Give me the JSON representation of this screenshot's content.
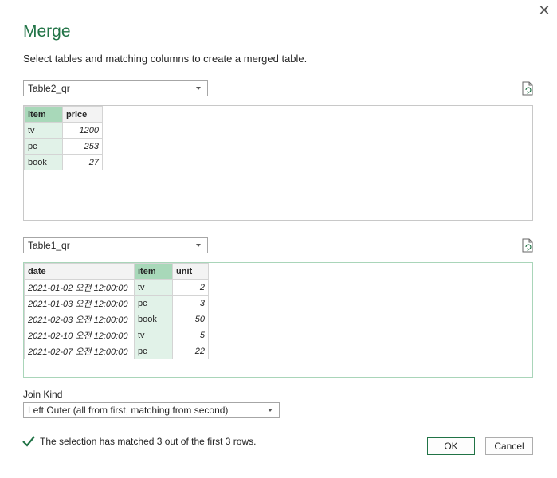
{
  "dialog": {
    "title": "Merge",
    "subtitle": "Select tables and matching columns to create a merged table."
  },
  "top_table": {
    "selected": "Table2_qr",
    "columns": [
      "item",
      "price"
    ],
    "rows": [
      [
        "tv",
        "1200"
      ],
      [
        "pc",
        "253"
      ],
      [
        "book",
        "27"
      ]
    ]
  },
  "bottom_table": {
    "selected": "Table1_qr",
    "columns": [
      "date",
      "item",
      "unit"
    ],
    "rows": [
      [
        "2021-01-02 오전 12:00:00",
        "tv",
        "2"
      ],
      [
        "2021-01-03 오전 12:00:00",
        "pc",
        "3"
      ],
      [
        "2021-02-03 오전 12:00:00",
        "book",
        "50"
      ],
      [
        "2021-02-10 오전 12:00:00",
        "tv",
        "5"
      ],
      [
        "2021-02-07 오전 12:00:00",
        "pc",
        "22"
      ]
    ]
  },
  "join": {
    "label": "Join Kind",
    "selected": "Left Outer (all from first, matching from second)"
  },
  "status": {
    "text": "The selection has matched 3 out of the first 3 rows."
  },
  "buttons": {
    "ok": "OK",
    "cancel": "Cancel"
  },
  "colors": {
    "accent": "#217346",
    "match_header": "#a8d8b9",
    "match_cell": "#e1f2e8"
  }
}
